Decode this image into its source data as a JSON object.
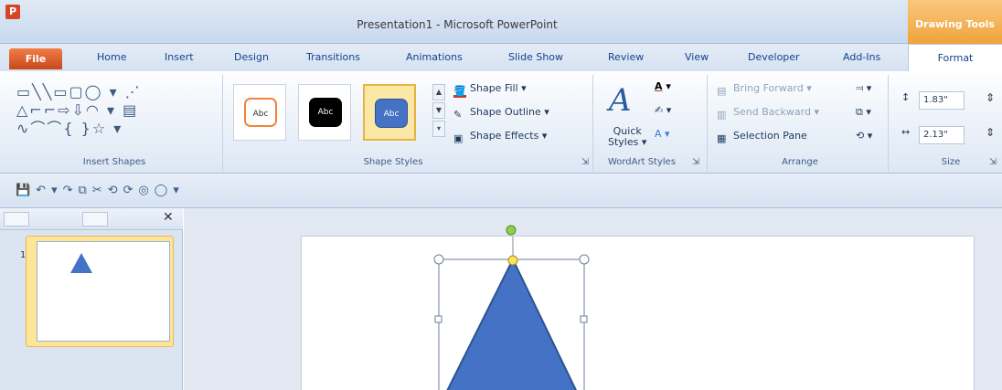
{
  "app": {
    "icon_letter": "P",
    "title": "Presentation1 - Microsoft PowerPoint",
    "context_tab": "Drawing Tools"
  },
  "tabs": [
    "File",
    "Home",
    "Insert",
    "Design",
    "Transitions",
    "Animations",
    "Slide Show",
    "Review",
    "View",
    "Developer",
    "Add-Ins",
    "Format"
  ],
  "ribbon": {
    "groups": {
      "insert_shapes": "Insert Shapes",
      "shape_styles": "Shape Styles",
      "wordart_styles": "WordArt Styles",
      "arrange": "Arrange",
      "size": "Size"
    },
    "shape_styles": {
      "presets": [
        "Abc",
        "Abc",
        "Abc"
      ],
      "fill": "Shape Fill",
      "outline": "Shape Outline",
      "effects": "Shape Effects"
    },
    "wordart": {
      "quick_styles_line1": "Quick",
      "quick_styles_line2": "Styles"
    },
    "arrange": {
      "bring_forward": "Bring Forward",
      "send_backward": "Send Backward",
      "selection_pane": "Selection Pane"
    },
    "size": {
      "height": "1.83\"",
      "width": "2.13\""
    }
  },
  "slides": {
    "first_number": "1"
  },
  "colors": {
    "shape_fill": "#4472c4",
    "file_tab": "#e0622b",
    "context_orange": "#f0a33a",
    "selection_row": "#fde59a"
  }
}
